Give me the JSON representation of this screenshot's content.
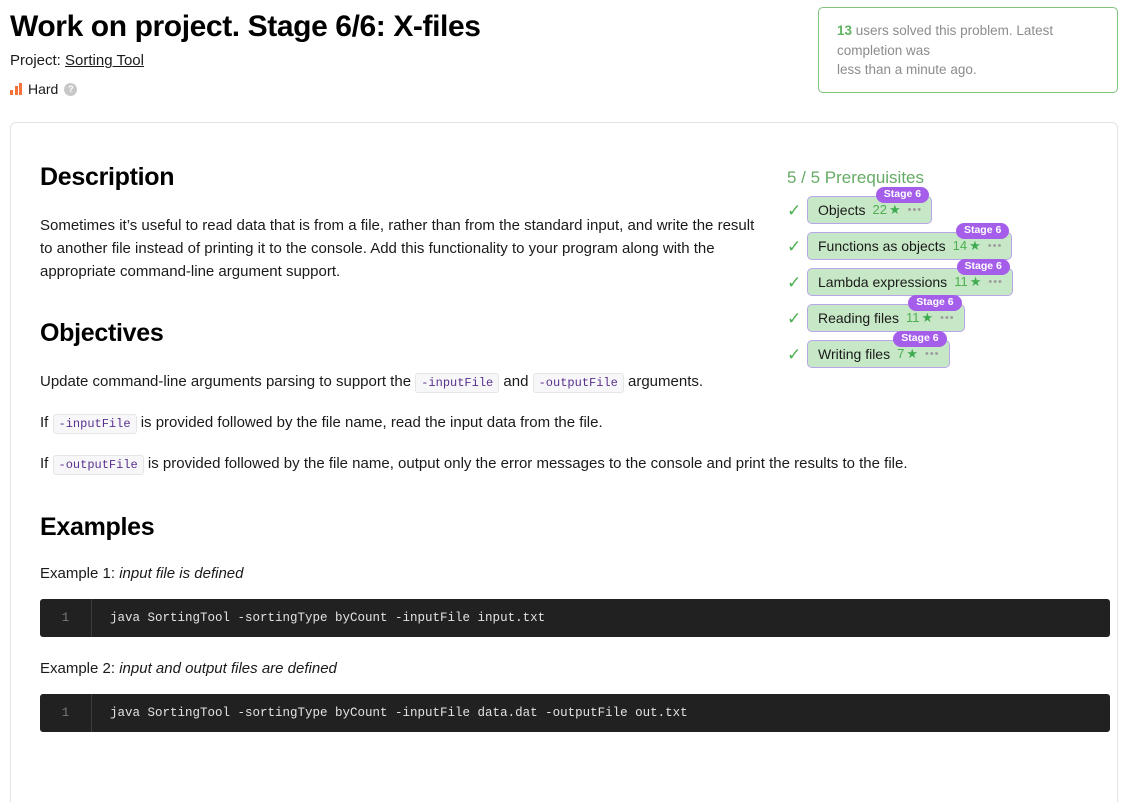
{
  "header": {
    "title": "Work on project. Stage 6/6: X-files",
    "project_label": "Project:",
    "project_name": "Sorting Tool",
    "difficulty": "Hard",
    "help_glyph": "?",
    "difficulty_icon": "bar-chart-icon",
    "difficulty_color": "#f4743b"
  },
  "info_box": {
    "count": "13",
    "text_part1": " users solved this problem. Latest completion was",
    "text_part2": "less than a minute ago.",
    "border_color": "#7fc47f",
    "count_color": "#5fb45f"
  },
  "prerequisites": {
    "title": "5 / 5 Prerequisites",
    "title_color": "#66ab66",
    "check_glyph": "✓",
    "star_glyph": "★",
    "dots_glyph": "•••",
    "badge_color": "#a55eea",
    "pill_bg": "#c7e8c7",
    "pill_border": "#b6a6e8",
    "items": [
      {
        "label": "Objects",
        "stars": "22",
        "stage": "Stage 6"
      },
      {
        "label": "Functions as objects",
        "stars": "14",
        "stage": "Stage 6"
      },
      {
        "label": "Lambda expressions",
        "stars": "11",
        "stage": "Stage 6"
      },
      {
        "label": "Reading files",
        "stars": "11",
        "stage": "Stage 6"
      },
      {
        "label": "Writing files",
        "stars": "7",
        "stage": "Stage 6"
      }
    ]
  },
  "description": {
    "heading": "Description",
    "paragraph": "Sometimes it’s useful to read data that is from a file, rather than from the standard input, and write the result to another file instead of printing it to the console. Add this functionality to your program along with the appropriate command-line argument support."
  },
  "objectives": {
    "heading": "Objectives",
    "p1_before": "Update command-line arguments parsing to support the ",
    "p1_code1": "-inputFile",
    "p1_mid": " and ",
    "p1_code2": "-outputFile",
    "p1_after": " arguments.",
    "p2_before": "If ",
    "p2_code": "-inputFile",
    "p2_after": " is provided followed by the file name, read the input data from the file.",
    "p3_before": "If ",
    "p3_code": "-outputFile",
    "p3_after": " is provided followed by the file name, output only the error messages to the console and print the results to the file."
  },
  "examples": {
    "heading": "Examples",
    "items": [
      {
        "label_prefix": "Example 1: ",
        "label_italic": "input file is defined",
        "line_number": "1",
        "code": "java SortingTool -sortingType byCount -inputFile input.txt"
      },
      {
        "label_prefix": "Example 2: ",
        "label_italic": "input and output files are defined",
        "line_number": "1",
        "code": "java SortingTool -sortingType byCount -inputFile data.dat -outputFile out.txt"
      }
    ]
  }
}
